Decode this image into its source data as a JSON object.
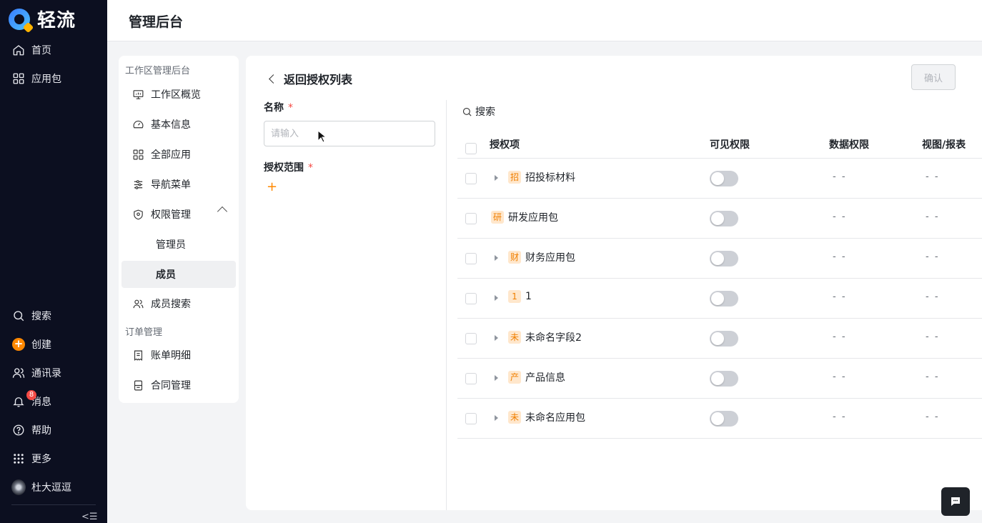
{
  "app": {
    "logo_text": "轻流"
  },
  "leftnav": {
    "top_items": [
      {
        "label": "首页",
        "icon": "home-icon"
      },
      {
        "label": "应用包",
        "icon": "grid-icon"
      }
    ],
    "bottom_items": [
      {
        "label": "搜索",
        "icon": "search-icon"
      },
      {
        "label": "创建",
        "icon": "plus-circle-icon"
      },
      {
        "label": "通讯录",
        "icon": "contacts-icon"
      },
      {
        "label": "消息",
        "icon": "bell-icon",
        "badge": "8"
      },
      {
        "label": "帮助",
        "icon": "help-icon"
      },
      {
        "label": "更多",
        "icon": "dots-grid-icon"
      },
      {
        "label": "杜大逗逗",
        "icon": "avatar"
      }
    ],
    "collapse_label": "<☰"
  },
  "header": {
    "title": "管理后台"
  },
  "subsidebar": {
    "section1_title": "工作区管理后台",
    "items": [
      {
        "label": "工作区概览",
        "icon": "monitor-icon"
      },
      {
        "label": "基本信息",
        "icon": "gauge-icon"
      },
      {
        "label": "全部应用",
        "icon": "apps-icon"
      },
      {
        "label": "导航菜单",
        "icon": "sliders-icon"
      },
      {
        "label": "权限管理",
        "icon": "shield-icon"
      }
    ],
    "children": [
      {
        "label": "管理员"
      },
      {
        "label": "成员"
      }
    ],
    "member_search": {
      "label": "成员搜索",
      "icon": "users-icon"
    },
    "section2_title": "订单管理",
    "order_items": [
      {
        "label": "账单明细",
        "icon": "bill-icon"
      },
      {
        "label": "合同管理",
        "icon": "contract-icon"
      }
    ]
  },
  "main": {
    "back_label": "返回授权列表",
    "confirm_label": "确认",
    "form": {
      "name_label": "名称",
      "name_placeholder": "请输入",
      "scope_label": "授权范围",
      "required_mark": "*",
      "add_symbol": "+"
    },
    "search_label": "搜索",
    "table": {
      "columns": [
        "授权项",
        "可见权限",
        "数据权限",
        "视图/报表"
      ],
      "rows": [
        {
          "chip": "招",
          "name": "招投标材料",
          "expandable": true,
          "visible": false,
          "data_perm": "- -",
          "view_perm": "- -"
        },
        {
          "chip": "研",
          "name": "研发应用包",
          "expandable": false,
          "visible": false,
          "data_perm": "- -",
          "view_perm": "- -"
        },
        {
          "chip": "财",
          "name": "财务应用包",
          "expandable": true,
          "visible": false,
          "data_perm": "- -",
          "view_perm": "- -"
        },
        {
          "chip": "1",
          "name": "1",
          "expandable": true,
          "visible": false,
          "data_perm": "- -",
          "view_perm": "- -"
        },
        {
          "chip": "未",
          "name": "未命名字段2",
          "expandable": true,
          "visible": false,
          "data_perm": "- -",
          "view_perm": "- -"
        },
        {
          "chip": "产",
          "name": "产品信息",
          "expandable": true,
          "visible": false,
          "data_perm": "- -",
          "view_perm": "- -"
        },
        {
          "chip": "未",
          "name": "未命名应用包",
          "expandable": true,
          "visible": false,
          "data_perm": "- -",
          "view_perm": "- -"
        }
      ]
    }
  },
  "colors": {
    "accent": "#ff8800",
    "nav_bg": "#0c0f20",
    "chip_bg": "#ffe7cc",
    "chip_text": "#f07f00",
    "toggle_off": "#cdd0d6"
  }
}
